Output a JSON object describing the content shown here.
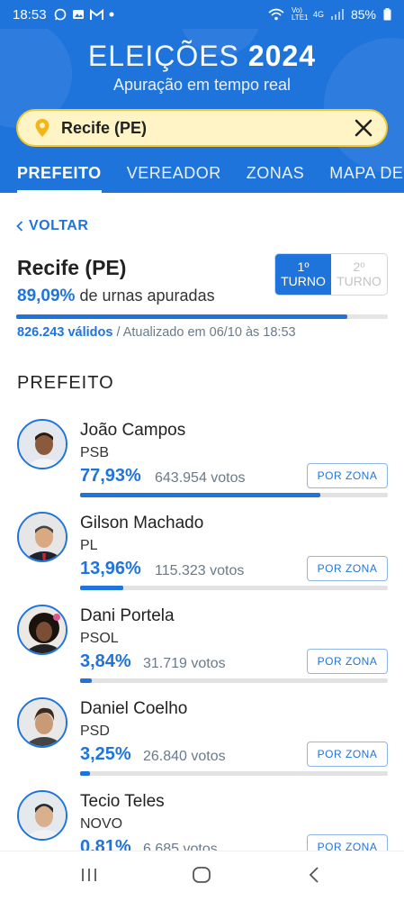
{
  "status_bar": {
    "time": "18:53",
    "network": "Vo) LTE1",
    "signal_type": "4G",
    "battery": "85%"
  },
  "header": {
    "title_light": "ELEIÇÕES",
    "title_bold": "2024",
    "subtitle": "Apuração em tempo real"
  },
  "search": {
    "value": "Recife (PE)"
  },
  "tabs": [
    {
      "label": "PREFEITO",
      "active": true
    },
    {
      "label": "VEREADOR",
      "active": false
    },
    {
      "label": "ZONAS",
      "active": false
    },
    {
      "label": "MAPA DE ELE",
      "active": false
    }
  ],
  "content": {
    "back_label": "VOLTAR",
    "city": "Recife (PE)",
    "apuradas_pct": "89,09%",
    "apuradas_text": "de urnas apuradas",
    "apuradas_fraction": 0.8909,
    "validos": "826.243 válidos",
    "updated": "/ Atualizado em 06/10 às 18:53",
    "turno1_num": "1º",
    "turno1_label": "TURNO",
    "turno2_num": "2º",
    "turno2_label": "TURNO",
    "section_title": "PREFEITO",
    "button_label": "POR ZONA"
  },
  "candidates": [
    {
      "name": "João Campos",
      "party": "PSB",
      "pct": "77,93%",
      "votes": "643.954 votos",
      "fraction": 0.7793
    },
    {
      "name": "Gilson Machado",
      "party": "PL",
      "pct": "13,96%",
      "votes": "115.323 votos",
      "fraction": 0.1396
    },
    {
      "name": "Dani Portela",
      "party": "PSOL",
      "pct": "3,84%",
      "votes": "31.719 votos",
      "fraction": 0.0384
    },
    {
      "name": "Daniel Coelho",
      "party": "PSD",
      "pct": "3,25%",
      "votes": "26.840 votos",
      "fraction": 0.0325
    },
    {
      "name": "Tecio Teles",
      "party": "NOVO",
      "pct": "0,81%",
      "votes": "6.685 votos",
      "fraction": 0.0081
    }
  ],
  "colors": {
    "primary": "#1f74dc",
    "search_bg": "#fff4c6",
    "search_border": "#f2c730",
    "pin": "#f2b51a"
  }
}
